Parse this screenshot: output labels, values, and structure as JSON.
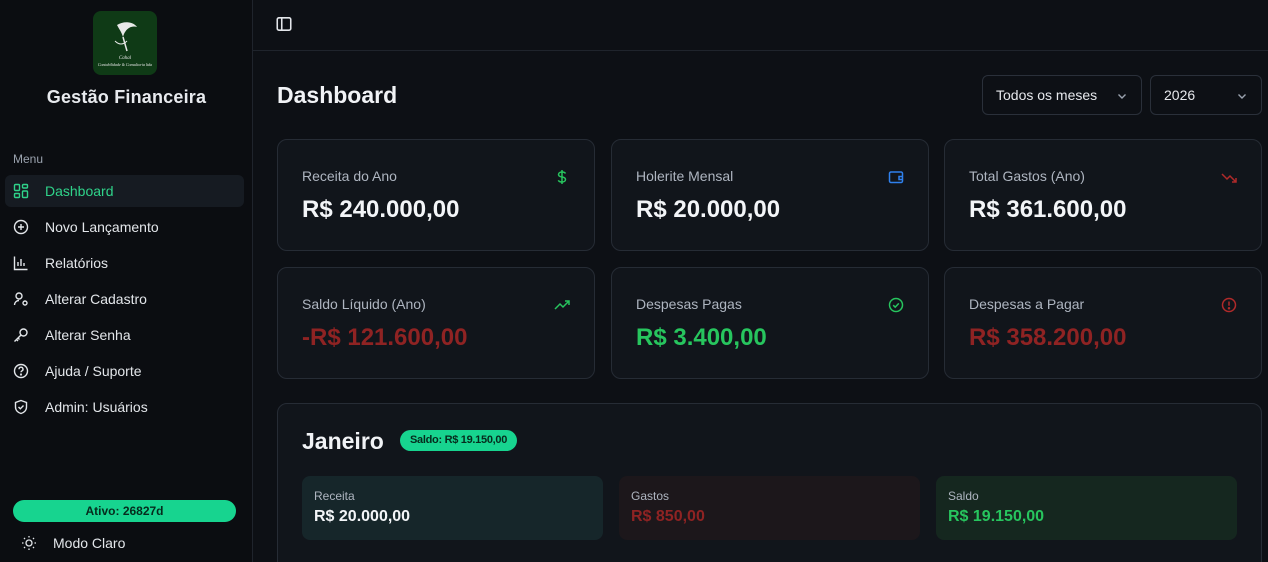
{
  "sidebar": {
    "brand": "Gestão Financeira",
    "logo_text": "Cahal Contabilidade & Consultoria ltda",
    "menu_label": "Menu",
    "items": [
      {
        "label": "Dashboard",
        "icon": "dashboard-icon",
        "active": true
      },
      {
        "label": "Novo Lançamento",
        "icon": "plus-circle-icon"
      },
      {
        "label": "Relatórios",
        "icon": "bar-chart-icon"
      },
      {
        "label": "Alterar Cadastro",
        "icon": "user-cog-icon"
      },
      {
        "label": "Alterar Senha",
        "icon": "key-icon"
      },
      {
        "label": "Ajuda / Suporte",
        "icon": "help-circle-icon"
      },
      {
        "label": "Admin: Usuários",
        "icon": "shield-icon"
      }
    ],
    "status": "Ativo: 26827d",
    "theme_toggle": "Modo Claro"
  },
  "header": {
    "title": "Dashboard",
    "month_select": "Todos os meses",
    "year_select": "2026"
  },
  "cards": [
    {
      "label": "Receita do Ano",
      "value": "R$ 240.000,00",
      "icon": "dollar-icon"
    },
    {
      "label": "Holerite Mensal",
      "value": "R$ 20.000,00",
      "icon": "wallet-icon"
    },
    {
      "label": "Total Gastos (Ano)",
      "value": "R$ 361.600,00",
      "icon": "trending-down-icon"
    },
    {
      "label": "Saldo Líquido (Ano)",
      "value": "-R$ 121.600,00",
      "icon": "trending-up-icon"
    },
    {
      "label": "Despesas Pagas",
      "value": "R$ 3.400,00",
      "icon": "check-circle-icon"
    },
    {
      "label": "Despesas a Pagar",
      "value": "R$ 358.200,00",
      "icon": "alert-circle-icon"
    }
  ],
  "month": {
    "title": "Janeiro",
    "badge": "Saldo: R$ 19.150,00",
    "receita_label": "Receita",
    "receita_value": "R$ 20.000,00",
    "gastos_label": "Gastos",
    "gastos_value": "R$ 850,00",
    "saldo_label": "Saldo",
    "saldo_value": "R$ 19.150,00"
  },
  "colors": {
    "accent": "#17d48f",
    "positive": "#27c55e",
    "negative": "#8f2323",
    "info": "#2f80ed"
  }
}
